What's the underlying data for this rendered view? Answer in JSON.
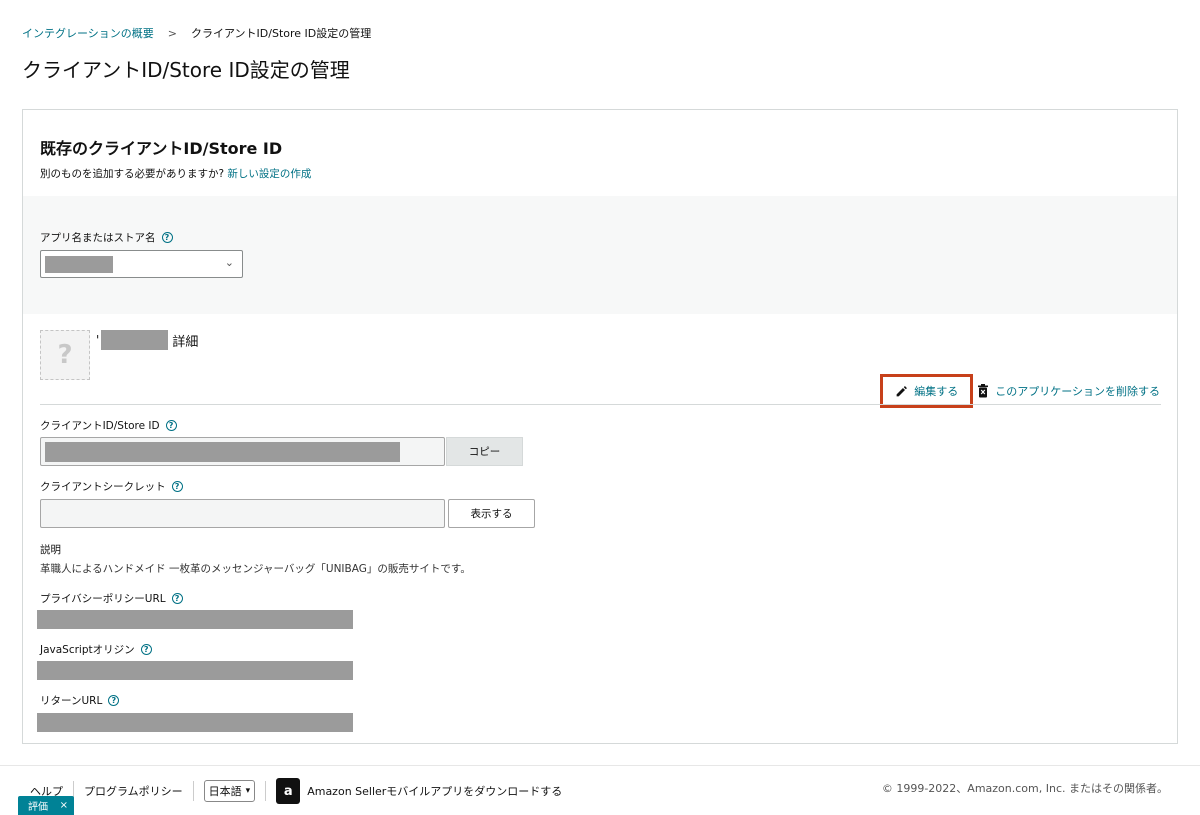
{
  "breadcrumb": {
    "parent": "インテグレーションの概要",
    "separator": ">",
    "current": "クライアントID/Store ID設定の管理"
  },
  "page_title": "クライアントID/Store ID設定の管理",
  "card": {
    "title": "既存のクライアントID/Store ID",
    "subtitle_prefix": "別のものを追加する必要がありますか?",
    "subtitle_link": "新しい設定の作成"
  },
  "filter": {
    "label": "アプリ名またはストア名",
    "chevron": "⌄"
  },
  "app": {
    "thumb_placeholder": "?",
    "quote_mark": "'",
    "detail_suffix": "詳細",
    "edit_label": "編集する",
    "delete_label": "このアプリケーションを削除する"
  },
  "fields": {
    "client_id_label": "クライアントID/Store ID",
    "copy_button": "コピー",
    "client_secret_label": "クライアントシークレット",
    "show_button": "表示する",
    "description_label": "説明",
    "description_text": "革職人によるハンドメイド 一枚革のメッセンジャーバッグ「UNIBAG」の販売サイトです。",
    "privacy_label": "プライバシーポリシーURL",
    "js_origin_label": "JavaScriptオリジン",
    "return_url_label": "リターンURL"
  },
  "footer": {
    "help": "ヘルプ",
    "program_policy": "プログラムポリシー",
    "language": "日本語",
    "app_icon_letter": "a",
    "mobile_app": "Amazon Sellerモバイルアプリをダウンロードする",
    "copyright": "© 1999-2022、Amazon.com, Inc. またはその関係者。"
  },
  "rating_badge": {
    "label": "評価",
    "close": "×"
  },
  "colors": {
    "link": "#007185",
    "highlight_border": "#c7401a",
    "badge": "#008296"
  }
}
